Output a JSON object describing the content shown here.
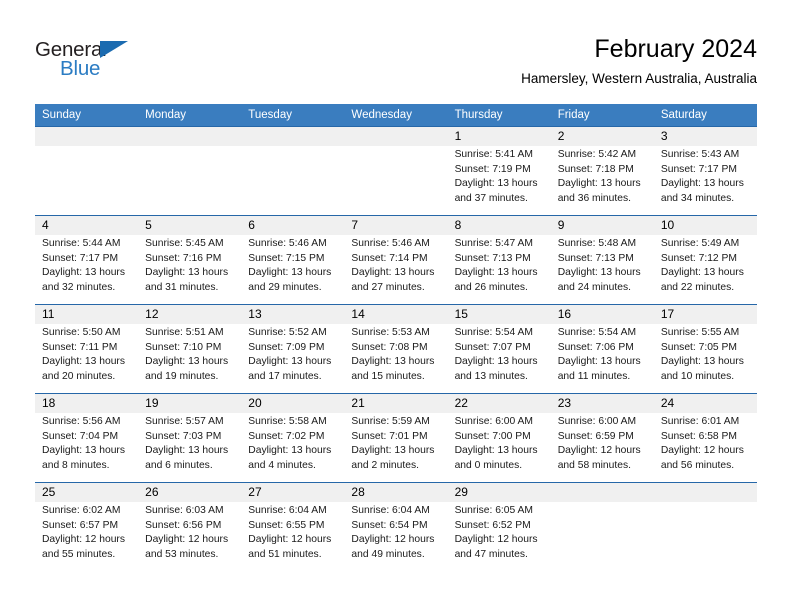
{
  "brand": {
    "name_part1": "General",
    "name_part2": "Blue",
    "triangle_color": "#1b6bb0",
    "blue_color": "#2b7cc3"
  },
  "header": {
    "title": "February 2024",
    "subtitle": "Hamersley, Western Australia, Australia"
  },
  "theme": {
    "header_row_bg": "#3a7dbf",
    "week_divider": "#2667a8",
    "daynum_band_bg": "#f0f0f0"
  },
  "weekday_headers": [
    "Sunday",
    "Monday",
    "Tuesday",
    "Wednesday",
    "Thursday",
    "Friday",
    "Saturday"
  ],
  "weeks": [
    [
      {
        "day": "",
        "sunrise": "",
        "sunset": "",
        "daylight_line1": "",
        "daylight_line2": ""
      },
      {
        "day": "",
        "sunrise": "",
        "sunset": "",
        "daylight_line1": "",
        "daylight_line2": ""
      },
      {
        "day": "",
        "sunrise": "",
        "sunset": "",
        "daylight_line1": "",
        "daylight_line2": ""
      },
      {
        "day": "",
        "sunrise": "",
        "sunset": "",
        "daylight_line1": "",
        "daylight_line2": ""
      },
      {
        "day": "1",
        "sunrise": "Sunrise: 5:41 AM",
        "sunset": "Sunset: 7:19 PM",
        "daylight_line1": "Daylight: 13 hours",
        "daylight_line2": "and 37 minutes."
      },
      {
        "day": "2",
        "sunrise": "Sunrise: 5:42 AM",
        "sunset": "Sunset: 7:18 PM",
        "daylight_line1": "Daylight: 13 hours",
        "daylight_line2": "and 36 minutes."
      },
      {
        "day": "3",
        "sunrise": "Sunrise: 5:43 AM",
        "sunset": "Sunset: 7:17 PM",
        "daylight_line1": "Daylight: 13 hours",
        "daylight_line2": "and 34 minutes."
      }
    ],
    [
      {
        "day": "4",
        "sunrise": "Sunrise: 5:44 AM",
        "sunset": "Sunset: 7:17 PM",
        "daylight_line1": "Daylight: 13 hours",
        "daylight_line2": "and 32 minutes."
      },
      {
        "day": "5",
        "sunrise": "Sunrise: 5:45 AM",
        "sunset": "Sunset: 7:16 PM",
        "daylight_line1": "Daylight: 13 hours",
        "daylight_line2": "and 31 minutes."
      },
      {
        "day": "6",
        "sunrise": "Sunrise: 5:46 AM",
        "sunset": "Sunset: 7:15 PM",
        "daylight_line1": "Daylight: 13 hours",
        "daylight_line2": "and 29 minutes."
      },
      {
        "day": "7",
        "sunrise": "Sunrise: 5:46 AM",
        "sunset": "Sunset: 7:14 PM",
        "daylight_line1": "Daylight: 13 hours",
        "daylight_line2": "and 27 minutes."
      },
      {
        "day": "8",
        "sunrise": "Sunrise: 5:47 AM",
        "sunset": "Sunset: 7:13 PM",
        "daylight_line1": "Daylight: 13 hours",
        "daylight_line2": "and 26 minutes."
      },
      {
        "day": "9",
        "sunrise": "Sunrise: 5:48 AM",
        "sunset": "Sunset: 7:13 PM",
        "daylight_line1": "Daylight: 13 hours",
        "daylight_line2": "and 24 minutes."
      },
      {
        "day": "10",
        "sunrise": "Sunrise: 5:49 AM",
        "sunset": "Sunset: 7:12 PM",
        "daylight_line1": "Daylight: 13 hours",
        "daylight_line2": "and 22 minutes."
      }
    ],
    [
      {
        "day": "11",
        "sunrise": "Sunrise: 5:50 AM",
        "sunset": "Sunset: 7:11 PM",
        "daylight_line1": "Daylight: 13 hours",
        "daylight_line2": "and 20 minutes."
      },
      {
        "day": "12",
        "sunrise": "Sunrise: 5:51 AM",
        "sunset": "Sunset: 7:10 PM",
        "daylight_line1": "Daylight: 13 hours",
        "daylight_line2": "and 19 minutes."
      },
      {
        "day": "13",
        "sunrise": "Sunrise: 5:52 AM",
        "sunset": "Sunset: 7:09 PM",
        "daylight_line1": "Daylight: 13 hours",
        "daylight_line2": "and 17 minutes."
      },
      {
        "day": "14",
        "sunrise": "Sunrise: 5:53 AM",
        "sunset": "Sunset: 7:08 PM",
        "daylight_line1": "Daylight: 13 hours",
        "daylight_line2": "and 15 minutes."
      },
      {
        "day": "15",
        "sunrise": "Sunrise: 5:54 AM",
        "sunset": "Sunset: 7:07 PM",
        "daylight_line1": "Daylight: 13 hours",
        "daylight_line2": "and 13 minutes."
      },
      {
        "day": "16",
        "sunrise": "Sunrise: 5:54 AM",
        "sunset": "Sunset: 7:06 PM",
        "daylight_line1": "Daylight: 13 hours",
        "daylight_line2": "and 11 minutes."
      },
      {
        "day": "17",
        "sunrise": "Sunrise: 5:55 AM",
        "sunset": "Sunset: 7:05 PM",
        "daylight_line1": "Daylight: 13 hours",
        "daylight_line2": "and 10 minutes."
      }
    ],
    [
      {
        "day": "18",
        "sunrise": "Sunrise: 5:56 AM",
        "sunset": "Sunset: 7:04 PM",
        "daylight_line1": "Daylight: 13 hours",
        "daylight_line2": "and 8 minutes."
      },
      {
        "day": "19",
        "sunrise": "Sunrise: 5:57 AM",
        "sunset": "Sunset: 7:03 PM",
        "daylight_line1": "Daylight: 13 hours",
        "daylight_line2": "and 6 minutes."
      },
      {
        "day": "20",
        "sunrise": "Sunrise: 5:58 AM",
        "sunset": "Sunset: 7:02 PM",
        "daylight_line1": "Daylight: 13 hours",
        "daylight_line2": "and 4 minutes."
      },
      {
        "day": "21",
        "sunrise": "Sunrise: 5:59 AM",
        "sunset": "Sunset: 7:01 PM",
        "daylight_line1": "Daylight: 13 hours",
        "daylight_line2": "and 2 minutes."
      },
      {
        "day": "22",
        "sunrise": "Sunrise: 6:00 AM",
        "sunset": "Sunset: 7:00 PM",
        "daylight_line1": "Daylight: 13 hours",
        "daylight_line2": "and 0 minutes."
      },
      {
        "day": "23",
        "sunrise": "Sunrise: 6:00 AM",
        "sunset": "Sunset: 6:59 PM",
        "daylight_line1": "Daylight: 12 hours",
        "daylight_line2": "and 58 minutes."
      },
      {
        "day": "24",
        "sunrise": "Sunrise: 6:01 AM",
        "sunset": "Sunset: 6:58 PM",
        "daylight_line1": "Daylight: 12 hours",
        "daylight_line2": "and 56 minutes."
      }
    ],
    [
      {
        "day": "25",
        "sunrise": "Sunrise: 6:02 AM",
        "sunset": "Sunset: 6:57 PM",
        "daylight_line1": "Daylight: 12 hours",
        "daylight_line2": "and 55 minutes."
      },
      {
        "day": "26",
        "sunrise": "Sunrise: 6:03 AM",
        "sunset": "Sunset: 6:56 PM",
        "daylight_line1": "Daylight: 12 hours",
        "daylight_line2": "and 53 minutes."
      },
      {
        "day": "27",
        "sunrise": "Sunrise: 6:04 AM",
        "sunset": "Sunset: 6:55 PM",
        "daylight_line1": "Daylight: 12 hours",
        "daylight_line2": "and 51 minutes."
      },
      {
        "day": "28",
        "sunrise": "Sunrise: 6:04 AM",
        "sunset": "Sunset: 6:54 PM",
        "daylight_line1": "Daylight: 12 hours",
        "daylight_line2": "and 49 minutes."
      },
      {
        "day": "29",
        "sunrise": "Sunrise: 6:05 AM",
        "sunset": "Sunset: 6:52 PM",
        "daylight_line1": "Daylight: 12 hours",
        "daylight_line2": "and 47 minutes."
      },
      {
        "day": "",
        "sunrise": "",
        "sunset": "",
        "daylight_line1": "",
        "daylight_line2": ""
      },
      {
        "day": "",
        "sunrise": "",
        "sunset": "",
        "daylight_line1": "",
        "daylight_line2": ""
      }
    ]
  ]
}
